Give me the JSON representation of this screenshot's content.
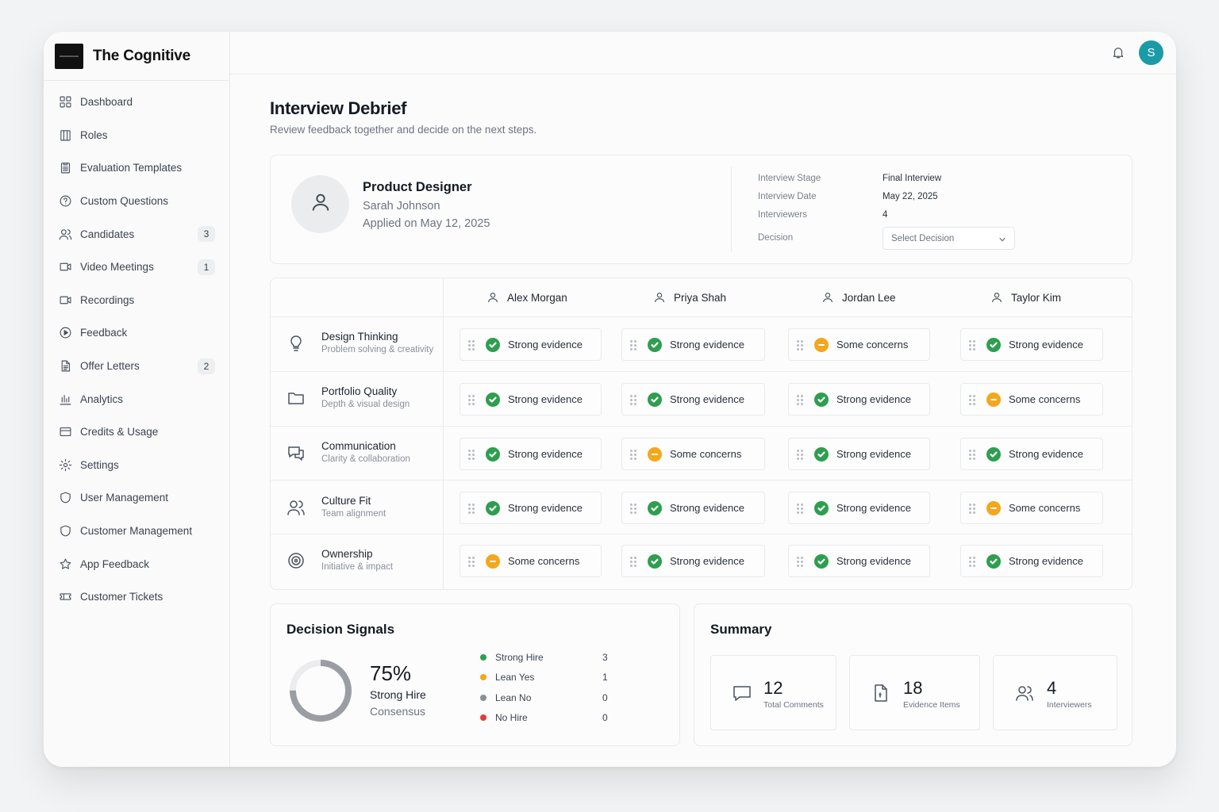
{
  "brand": {
    "name": "The Cognitive"
  },
  "sidebar": {
    "items": [
      {
        "label": "Dashboard",
        "icon": "dashboard-icon",
        "badge": ""
      },
      {
        "label": "Roles",
        "icon": "roles-icon",
        "badge": ""
      },
      {
        "label": "Evaluation Templates",
        "icon": "clipboard-icon",
        "badge": ""
      },
      {
        "label": "Custom Questions",
        "icon": "question-icon",
        "badge": ""
      },
      {
        "label": "Candidates",
        "icon": "users-icon",
        "badge": "3"
      },
      {
        "label": "Video Meetings",
        "icon": "video-icon",
        "badge": "1"
      },
      {
        "label": "Recordings",
        "icon": "recording-icon",
        "badge": ""
      },
      {
        "label": "Feedback",
        "icon": "feedback-icon",
        "badge": ""
      },
      {
        "label": "Offer Letters",
        "icon": "document-icon",
        "badge": "2"
      },
      {
        "label": "Analytics",
        "icon": "analytics-icon",
        "badge": ""
      },
      {
        "label": "Credits & Usage",
        "icon": "credit-card-icon",
        "badge": ""
      },
      {
        "label": "Settings",
        "icon": "gear-icon",
        "badge": ""
      },
      {
        "label": "User Management",
        "icon": "shield-icon",
        "badge": ""
      },
      {
        "label": "Customer Management",
        "icon": "shield-icon",
        "badge": ""
      },
      {
        "label": "App Feedback",
        "icon": "star-icon",
        "badge": ""
      },
      {
        "label": "Customer Tickets",
        "icon": "ticket-icon",
        "badge": ""
      }
    ]
  },
  "topbar": {
    "avatar_initial": "S",
    "avatar_color": "#1b9aa8"
  },
  "page": {
    "title": "Interview Debrief",
    "subtitle": "Review feedback together and decide on the next steps."
  },
  "candidate": {
    "role": "Product Designer",
    "name": "Sarah Johnson",
    "applied": "Applied on May 12, 2025",
    "meta": [
      {
        "label": "Interview Stage",
        "value": "Final Interview"
      },
      {
        "label": "Interview Date",
        "value": "May 22, 2025"
      },
      {
        "label": "Interviewers",
        "value": "4"
      }
    ],
    "decision_label": "Decision",
    "decision_placeholder": "Select Decision"
  },
  "evaluation": {
    "interviewers": [
      "Alex Morgan",
      "Priya Shah",
      "Jordan Lee",
      "Taylor Kim"
    ],
    "criteria": [
      {
        "title": "Design Thinking",
        "subtitle": "Problem solving & creativity",
        "icon": "lightbulb-icon",
        "ratings": [
          {
            "status": "good",
            "label": "Strong evidence"
          },
          {
            "status": "good",
            "label": "Strong evidence"
          },
          {
            "status": "warn",
            "label": "Some concerns"
          },
          {
            "status": "good",
            "label": "Strong evidence"
          }
        ]
      },
      {
        "title": "Portfolio Quality",
        "subtitle": "Depth & visual design",
        "icon": "folder-icon",
        "ratings": [
          {
            "status": "good",
            "label": "Strong evidence"
          },
          {
            "status": "good",
            "label": "Strong evidence"
          },
          {
            "status": "good",
            "label": "Strong evidence"
          },
          {
            "status": "warn",
            "label": "Some concerns"
          }
        ]
      },
      {
        "title": "Communication",
        "subtitle": "Clarity & collaboration",
        "icon": "chat-icon",
        "ratings": [
          {
            "status": "good",
            "label": "Strong evidence"
          },
          {
            "status": "warn",
            "label": "Some concerns"
          },
          {
            "status": "good",
            "label": "Strong evidence"
          },
          {
            "status": "good",
            "label": "Strong evidence"
          }
        ]
      },
      {
        "title": "Culture Fit",
        "subtitle": "Team alignment",
        "icon": "team-icon",
        "ratings": [
          {
            "status": "good",
            "label": "Strong evidence"
          },
          {
            "status": "good",
            "label": "Strong evidence"
          },
          {
            "status": "good",
            "label": "Strong evidence"
          },
          {
            "status": "warn",
            "label": "Some concerns"
          }
        ]
      },
      {
        "title": "Ownership",
        "subtitle": "Initiative & impact",
        "icon": "target-icon",
        "ratings": [
          {
            "status": "warn",
            "label": "Some concerns"
          },
          {
            "status": "good",
            "label": "Strong evidence"
          },
          {
            "status": "good",
            "label": "Strong evidence"
          },
          {
            "status": "good",
            "label": "Strong evidence"
          }
        ]
      }
    ],
    "colors": {
      "good": "#2e9e4f",
      "warn": "#f2a71d"
    }
  },
  "signals": {
    "title": "Decision Signals",
    "percent": "75%",
    "percent_value": 0.75,
    "line1": "Strong Hire",
    "line2": "Consensus",
    "legend": [
      {
        "label": "Strong Hire",
        "count": "3",
        "color": "#2e9e4f"
      },
      {
        "label": "Lean Yes",
        "count": "1",
        "color": "#f2a71d"
      },
      {
        "label": "Lean No",
        "count": "0",
        "color": "#8a8f96"
      },
      {
        "label": "No Hire",
        "count": "0",
        "color": "#e03b3b"
      }
    ]
  },
  "summary": {
    "title": "Summary",
    "stats": [
      {
        "value": "12",
        "label": "Total Comments",
        "icon": "comment-icon"
      },
      {
        "value": "18",
        "label": "Evidence Items",
        "icon": "evidence-file-icon"
      },
      {
        "value": "4",
        "label": "Interviewers",
        "icon": "users-icon"
      }
    ]
  }
}
